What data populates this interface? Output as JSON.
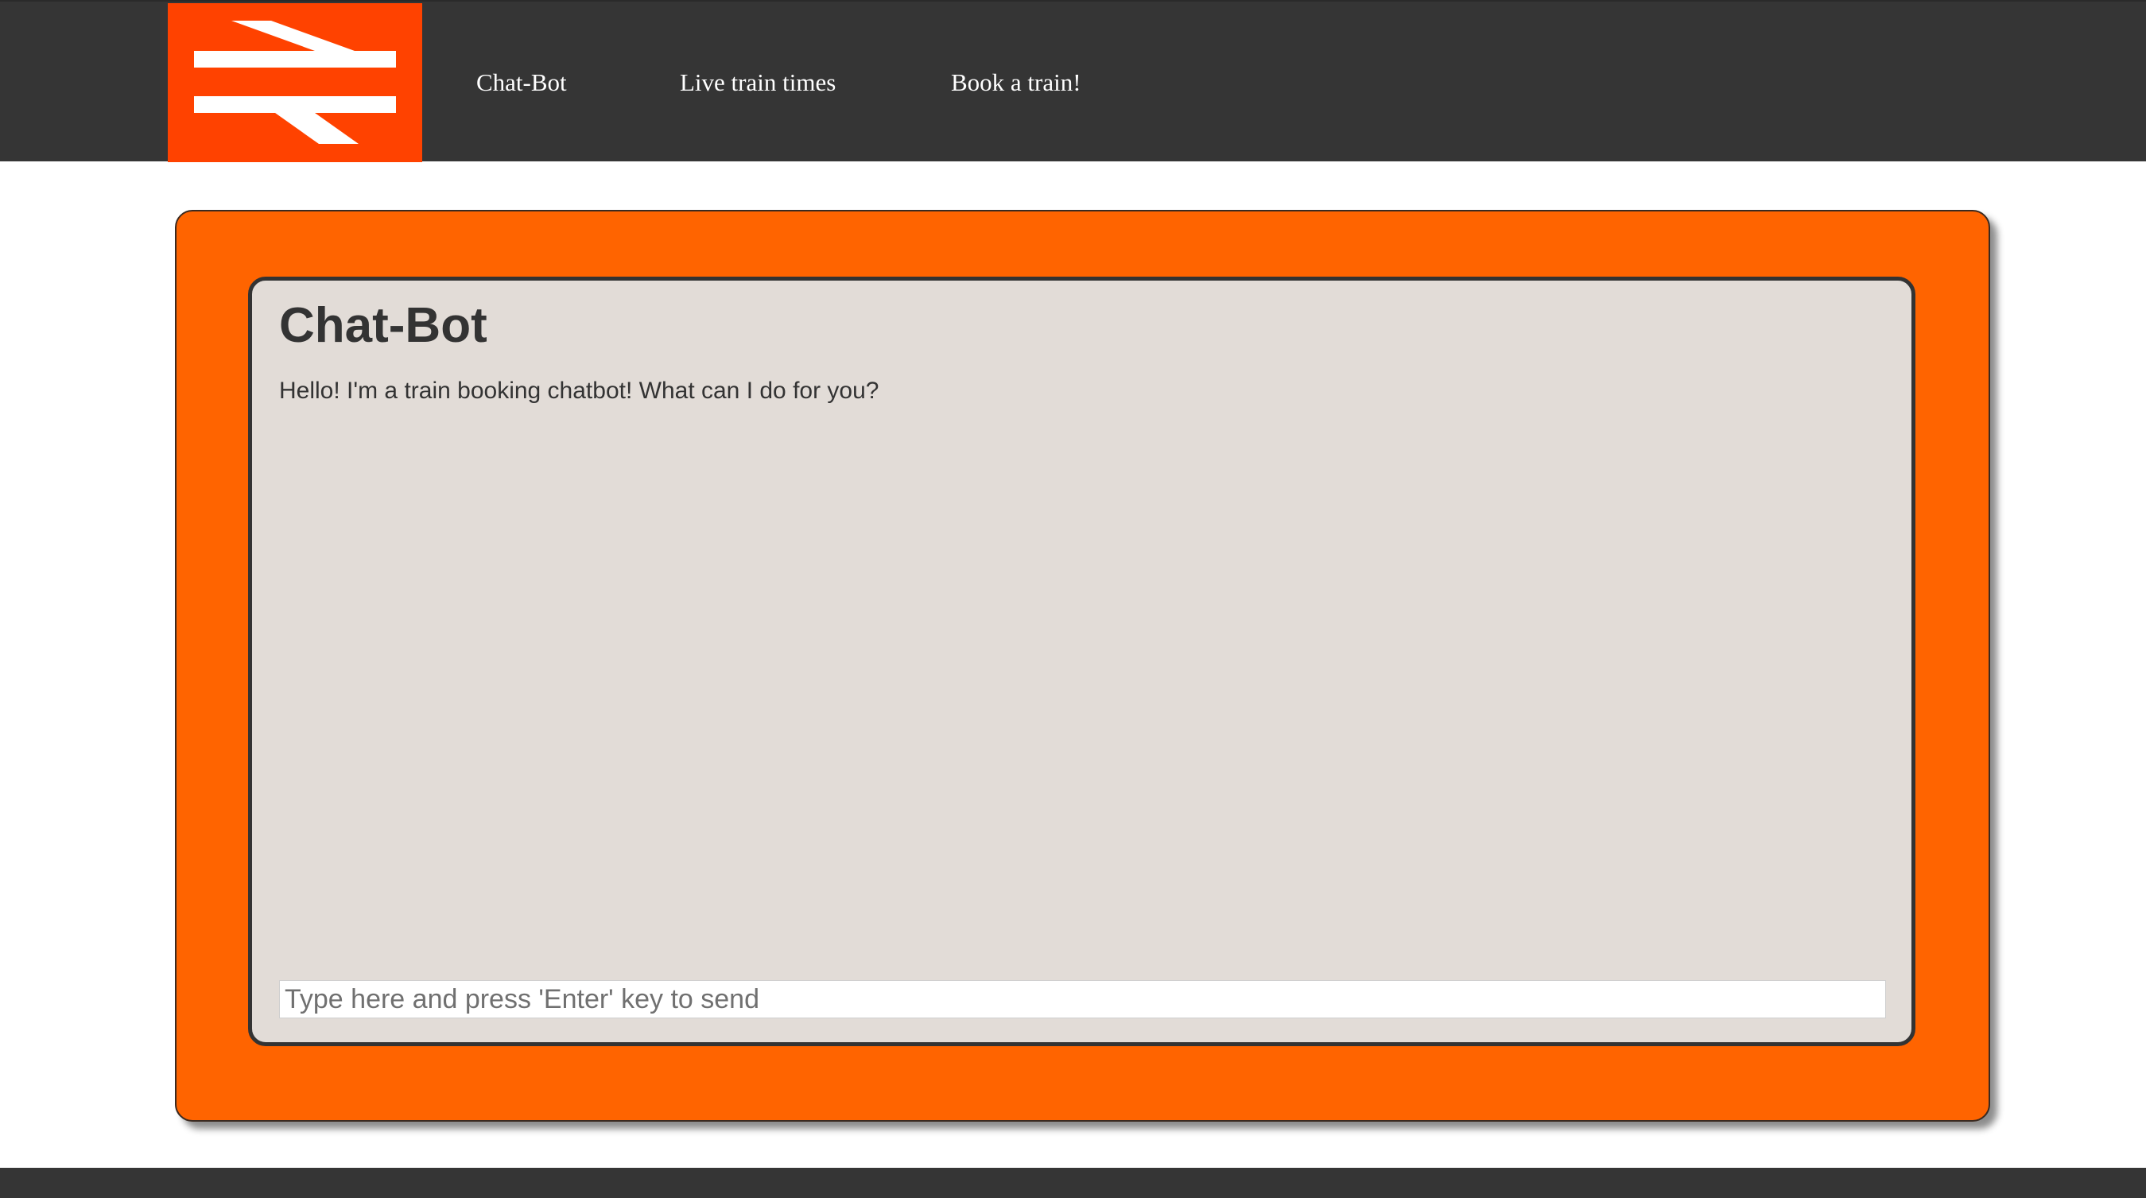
{
  "header": {
    "logo_icon": "british-rail-double-arrow-icon",
    "logo_background": "#ff4200",
    "nav": [
      {
        "label": "Chat-Bot"
      },
      {
        "label": "Live train times"
      },
      {
        "label": "Book a train!"
      }
    ]
  },
  "chat": {
    "title": "Chat-Bot",
    "messages": [
      {
        "text": "Hello! I'm a train booking chatbot! What can I do for you?"
      }
    ],
    "input": {
      "value": "",
      "placeholder": "Type here and press 'Enter' key to send"
    }
  },
  "colors": {
    "nav_background": "#353535",
    "card_orange": "#ff6400",
    "panel_background": "#e2dcd7",
    "text_dark": "#333333"
  }
}
